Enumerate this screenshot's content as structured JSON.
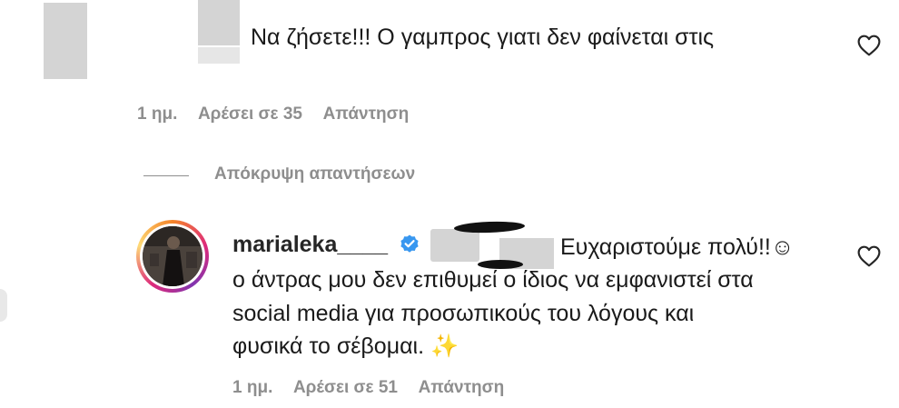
{
  "comment1": {
    "text": "Να ζήσετε!!! Ο γαμπρος γιατι δεν φαίνεται στις",
    "time": "1 ημ.",
    "likes": "Αρέσει σε 35",
    "reply": "Απάντηση"
  },
  "replies_toggle": {
    "label": "Απόκρυψη απαντήσεων"
  },
  "comment2": {
    "username": "marialeka____",
    "lines": [
      "Ευχαριστούμε πολύ!!☺",
      "ο άντρας μου δεν επιθυμεί ο ίδιος να εμφανιστεί στα",
      "social media για προσωπικούς του λόγους και",
      "φυσικά το σέβομαι. ✨"
    ],
    "time": "1 ημ.",
    "likes": "Αρέσει σε 51",
    "reply": "Απάντηση"
  },
  "colors": {
    "verified_badge": "#3897f0",
    "meta_text": "#8e8e8e",
    "avatar_ring": [
      "#f58529",
      "#dd2a7b",
      "#8134af"
    ]
  },
  "icons": [
    "heart-outline-icon",
    "verified-badge-icon",
    "sparkles-emoji"
  ]
}
